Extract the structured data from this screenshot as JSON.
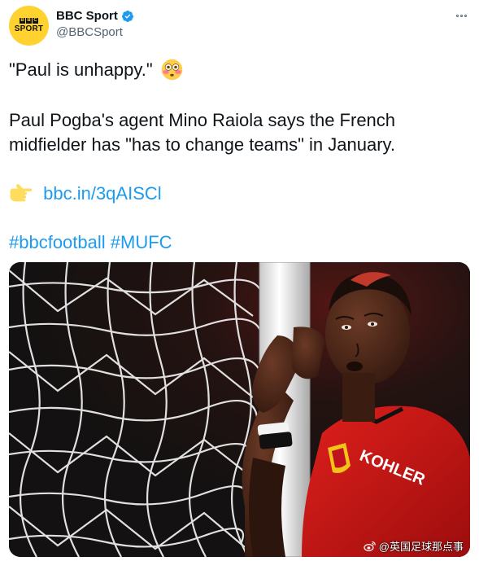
{
  "author": {
    "avatar": {
      "bbc_letters": [
        "B",
        "B",
        "C"
      ],
      "sport_text": "SPORT",
      "background": "#ffd230"
    },
    "display_name": "BBC Sport",
    "handle": "@BBCSport",
    "verified": true,
    "verified_icon": "verified-badge-icon"
  },
  "tweet": {
    "line_1": "\"Paul is unhappy.\"",
    "line_1_emoji": "flushed-face-icon",
    "line_2": "Paul Pogba's agent Mino Raiola says the French",
    "line_3": "midfielder has \"has to change teams\" in January.",
    "link_emoji": "pointing-right-icon",
    "link_text": "bbc.in/3qAISCl",
    "hashtags": [
      "#bbcfootball",
      "#MUFC"
    ]
  },
  "media": {
    "description_icon": "photo-footballer-at-goalpost",
    "shirt_sponsor": "KOHLER"
  },
  "watermark": {
    "text": "@英国足球那点事",
    "icon": "weibo-icon"
  },
  "colors": {
    "link": "#1d9bf0",
    "text": "#0f1419",
    "muted": "#536471",
    "verified": "#1d9bf0"
  }
}
